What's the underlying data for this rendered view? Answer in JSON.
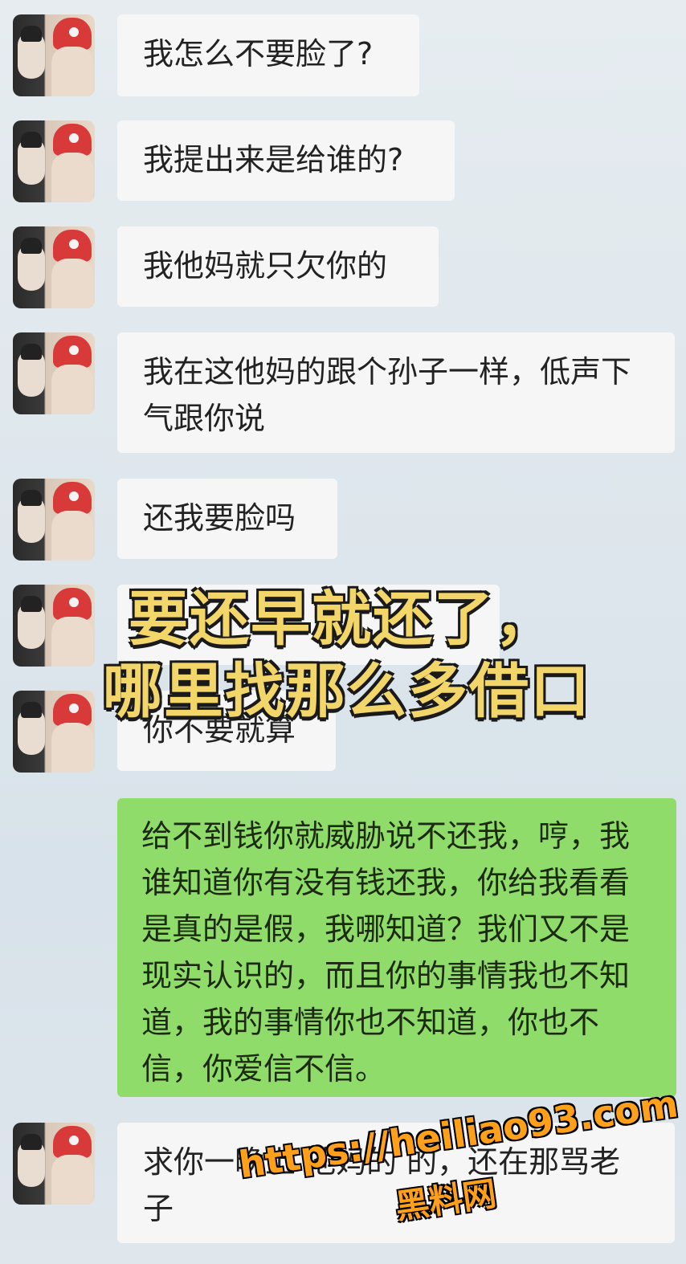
{
  "messages": [
    {
      "side": "left",
      "text": "我怎么不要脸了?"
    },
    {
      "side": "left",
      "text": "我提出来是给谁的?"
    },
    {
      "side": "left",
      "text": "我他妈就只欠你的"
    },
    {
      "side": "left",
      "text": "我在这他妈的跟个孙子一样，低声下气跟你说"
    },
    {
      "side": "left",
      "text": "还我要脸吗"
    },
    {
      "side": "left",
      "text": ""
    },
    {
      "side": "left",
      "text": "你不要就算"
    },
    {
      "side": "right",
      "text": "给不到钱你就威胁说不还我，哼，我谁知道你有没有钱还我，你给我看看是真的是假，我哪知道？我们又不是现实认识的，而且你的事情我也不知道，我的事情你也不知道，你也不信，你爱信不信。"
    },
    {
      "side": "left",
      "text": "求你一晚上 他妈的 的，还在那骂老子"
    }
  ],
  "overlay_caption": {
    "line1": "要还早就还了，",
    "line2": "哪里找那么多借口"
  },
  "watermark": {
    "url": "https://heiliao93.com",
    "name": "黑料网"
  },
  "colors": {
    "left_bubble": "#f6f6f6",
    "right_bubble": "#8fdc6a",
    "caption": "#f3d66a",
    "watermark": "#ff9f1a"
  }
}
